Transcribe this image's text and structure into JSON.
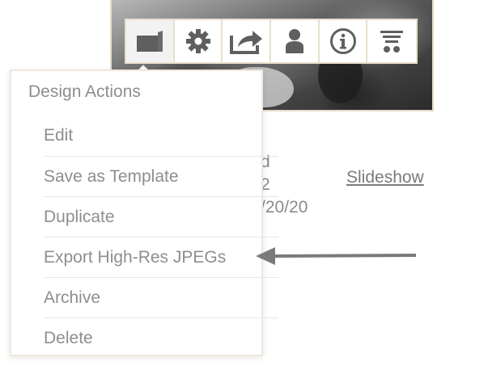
{
  "toolbar": {
    "buttons": [
      {
        "icon": "folder-icon"
      },
      {
        "icon": "gear-icon"
      },
      {
        "icon": "share-icon"
      },
      {
        "icon": "person-icon"
      },
      {
        "icon": "info-icon"
      },
      {
        "icon": "filter-icon"
      }
    ]
  },
  "card": {
    "line1": "d",
    "line2": "2",
    "line3": "/20/20",
    "slideshow_label": "Slideshow"
  },
  "dropdown": {
    "title": "Design Actions",
    "items": [
      {
        "label": "Edit"
      },
      {
        "label": "Save as Template"
      },
      {
        "label": "Duplicate"
      },
      {
        "label": "Export High-Res JPEGs"
      },
      {
        "label": "Archive"
      },
      {
        "label": "Delete"
      }
    ]
  },
  "colors": {
    "text": "#8e8e8e",
    "border": "#eadfce",
    "arrow": "#7a7a7a"
  }
}
